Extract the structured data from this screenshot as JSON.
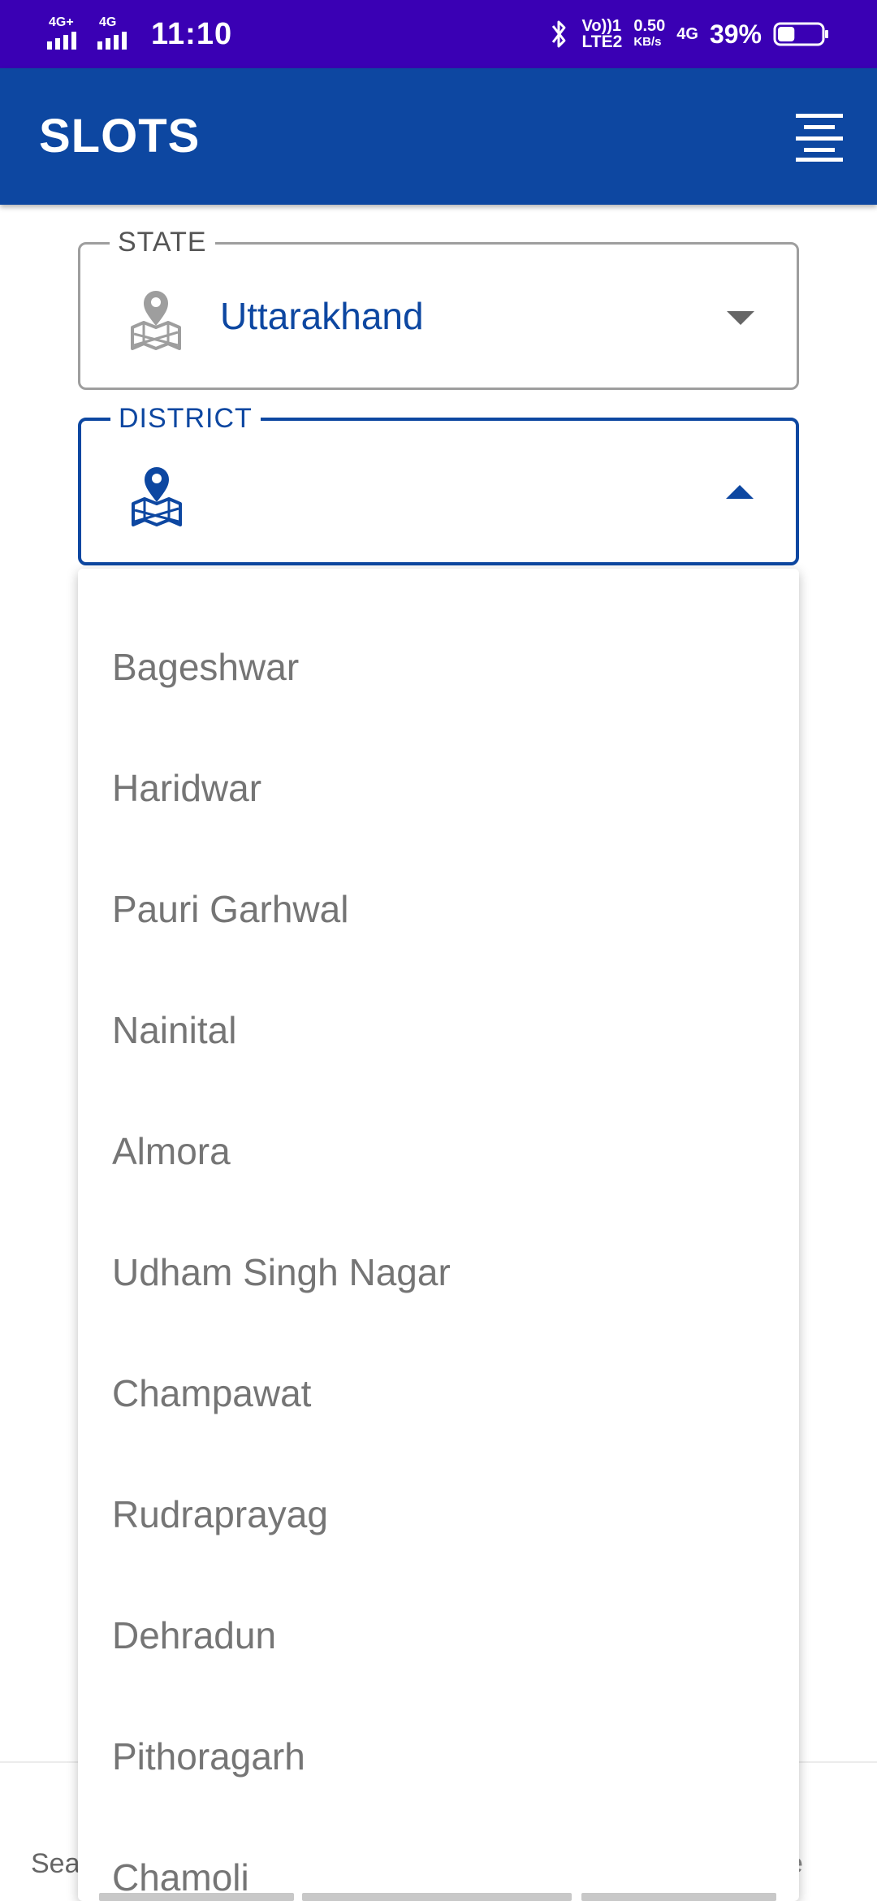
{
  "status_bar": {
    "sim1_label": "4G+",
    "sim2_label": "4G",
    "time": "11:10",
    "volte_top": "Vo))1",
    "volte_bottom": "LTE2",
    "speed_value": "0.50",
    "speed_unit": "KB/s",
    "network_label": "4G",
    "battery_percent": "39%",
    "battery_level": 0.39,
    "icons": [
      "bluetooth-icon",
      "battery-icon"
    ]
  },
  "app_bar": {
    "title": "SLOTS",
    "menu_icon": "menu-icon"
  },
  "state_field": {
    "label": "STATE",
    "value": "Uttarakhand",
    "icon": "map-pin-icon",
    "arrow": "caret-down-icon"
  },
  "district_field": {
    "label": "DISTRICT",
    "value": "",
    "icon": "map-pin-icon",
    "arrow": "caret-up-icon"
  },
  "district_options": [
    "Bageshwar",
    "Haridwar",
    "Pauri Garhwal",
    "Nainital",
    "Almora",
    "Udham Singh Nagar",
    "Champawat",
    "Rudraprayag",
    "Dehradun",
    "Pithoragarh",
    "Chamoli"
  ],
  "background": {
    "left_text": "Sea",
    "right_text": "e"
  },
  "colors": {
    "status_bar": "#3a00b4",
    "primary": "#0d47a1",
    "option_text": "#757575",
    "outline": "#9e9e9e"
  }
}
